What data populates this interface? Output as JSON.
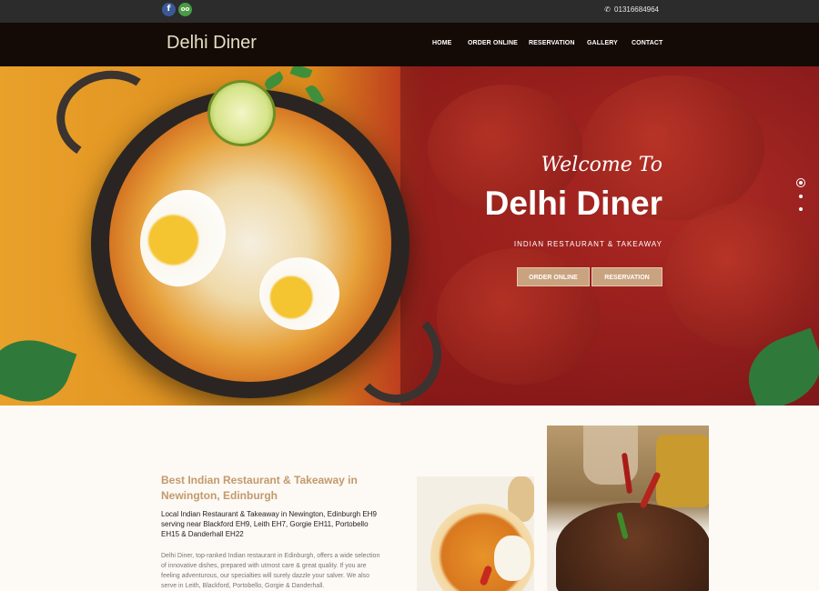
{
  "topbar": {
    "social": [
      {
        "name": "facebook-icon",
        "glyph": "f"
      },
      {
        "name": "tripadvisor-icon",
        "glyph": "oo"
      }
    ],
    "phone_icon": "✆",
    "phone": "01316684964"
  },
  "nav": {
    "brand": "Delhi Diner",
    "items": [
      "HOME",
      "ORDER ONLINE",
      "RESERVATION",
      "GALLERY",
      "CONTACT"
    ]
  },
  "hero": {
    "welcome": "Welcome To",
    "title": "Delhi Diner",
    "subtitle": "INDIAN RESTAURANT & TAKEAWAY",
    "buttons": [
      "ORDER ONLINE",
      "RESERVATION"
    ],
    "slides": 3,
    "active_slide": 1
  },
  "content": {
    "heading": "Best Indian Restaurant & Takeaway in Newington, Edinburgh",
    "intro": "Local Indian Restaurant & Takeaway in Newington, Edinburgh EH9 serving near Blackford EH9, Leith EH7, Gorgie EH11, Portobello EH15 & Danderhall EH22",
    "body": "Delhi Diner, top-ranked Indian restaurant in Edinburgh, offers a wide selection of innovative dishes, prepared with utmost care & great quality. If you are feeling adventurous, our specialties will surely dazzle your salver. We also serve in Leith, Blackford, Portobello, Gorgie & Danderhall."
  },
  "colors": {
    "accent": "#c29a6b",
    "button": "#c9a27f",
    "nav_bg": "#140b06",
    "topbar_bg": "#2c2c2c"
  }
}
